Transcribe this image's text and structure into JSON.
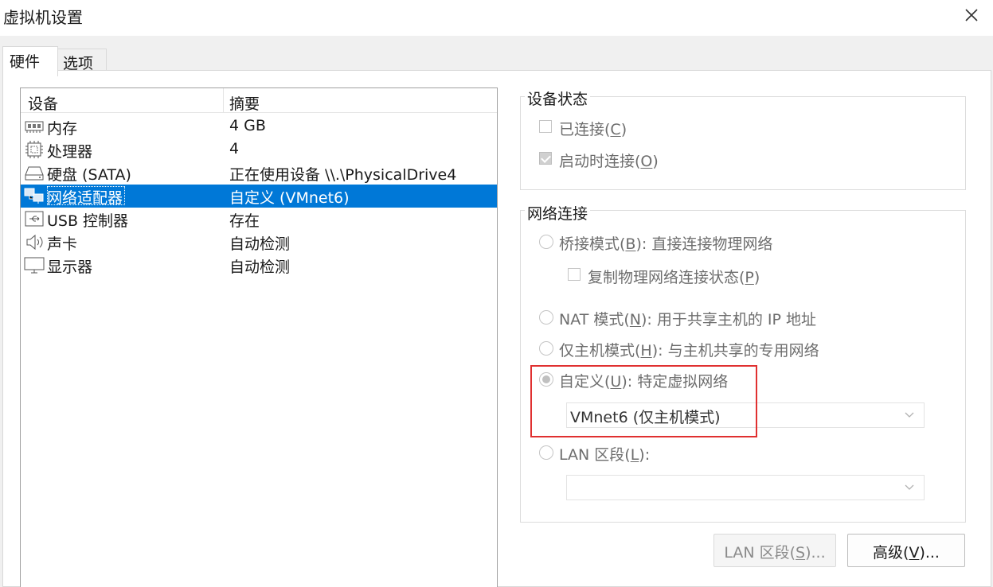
{
  "window": {
    "title": "虚拟机设置"
  },
  "tabs": [
    {
      "label": "硬件",
      "active": true
    },
    {
      "label": "选项",
      "active": false
    }
  ],
  "device_list": {
    "columns": [
      "设备",
      "摘要"
    ],
    "rows": [
      {
        "icon": "memory-icon",
        "name": "内存",
        "summary": "4 GB",
        "selected": false
      },
      {
        "icon": "processor-icon",
        "name": "处理器",
        "summary": "4",
        "selected": false
      },
      {
        "icon": "hard-disk-icon",
        "name": "硬盘 (SATA)",
        "summary": "正在使用设备 \\\\.\\PhysicalDrive4",
        "selected": false
      },
      {
        "icon": "network-adapter-icon",
        "name": "网络适配器",
        "summary": "自定义 (VMnet6)",
        "selected": true
      },
      {
        "icon": "usb-icon",
        "name": "USB 控制器",
        "summary": "存在",
        "selected": false
      },
      {
        "icon": "speaker-icon",
        "name": "声卡",
        "summary": "自动检测",
        "selected": false
      },
      {
        "icon": "monitor-icon",
        "name": "显示器",
        "summary": "自动检测",
        "selected": false
      }
    ]
  },
  "device_status": {
    "legend": "设备状态",
    "connected": {
      "text": "已连接(",
      "key": "C",
      "end": ")",
      "checked": false
    },
    "connect_at_power_on": {
      "text": "启动时连接(",
      "key": "O",
      "end": ")",
      "checked": true
    }
  },
  "network_connection": {
    "legend": "网络连接",
    "bridged": {
      "text": "桥接模式(",
      "key": "B",
      "end": "): 直接连接物理网络",
      "checked": false
    },
    "replicate": {
      "text": "复制物理网络连接状态(",
      "key": "P",
      "end": ")",
      "checked": false
    },
    "nat": {
      "text": "NAT 模式(",
      "key": "N",
      "end": "): 用于共享主机的 IP 地址",
      "checked": false
    },
    "host_only": {
      "text": "仅主机模式(",
      "key": "H",
      "end": "): 与主机共享的专用网络",
      "checked": false
    },
    "custom": {
      "text": "自定义(",
      "key": "U",
      "end": "): 特定虚拟网络",
      "checked": true
    },
    "custom_select_value": "VMnet6 (仅主机模式)",
    "lan_segment": {
      "text": "LAN 区段(",
      "key": "L",
      "end": "):",
      "checked": false
    },
    "lan_select_value": ""
  },
  "buttons": {
    "lan_segments": {
      "text": "LAN 区段(",
      "key": "S",
      "end": ")...",
      "enabled": false
    },
    "advanced": {
      "text": "高级(",
      "key": "V",
      "end": ")...",
      "enabled": true
    }
  },
  "colors": {
    "selection": "#0078d7",
    "highlight_box": "#e03030"
  }
}
